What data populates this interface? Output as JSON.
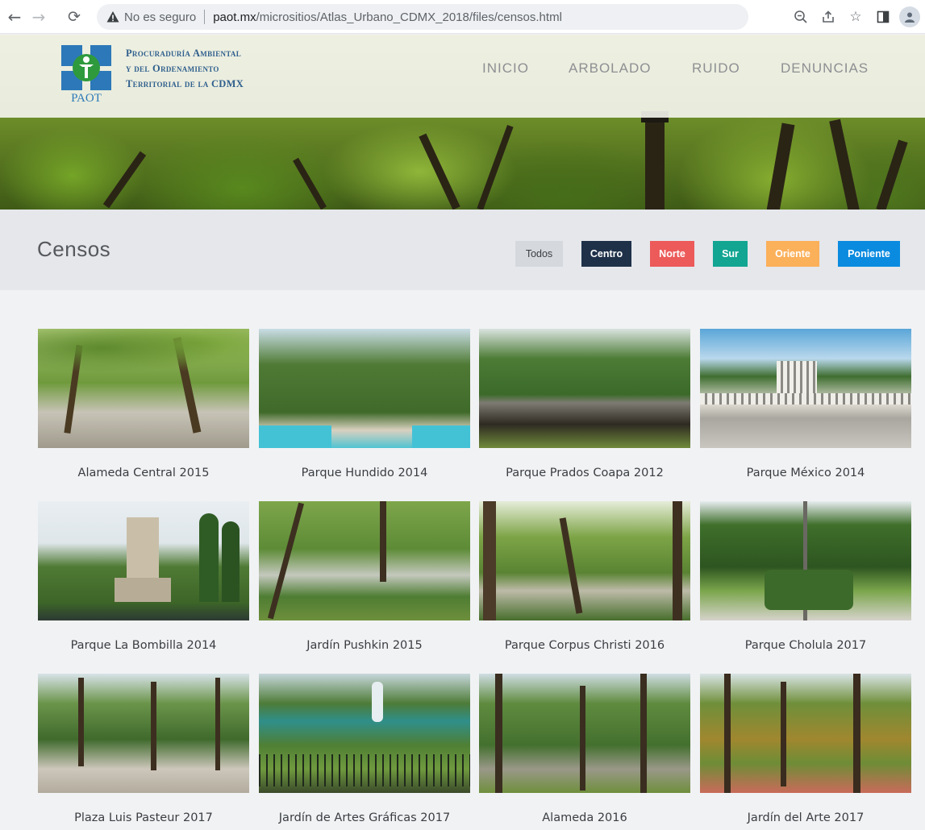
{
  "browser": {
    "insecure_label": "No es seguro",
    "url_host": "paot.mx",
    "url_path": "/micrositios/Atlas_Urbano_CDMX_2018/files/censos.html"
  },
  "site": {
    "logo_text_line1": "Procuraduría Ambiental",
    "logo_text_line2": "y del Ordenamiento",
    "logo_text_line3": "Territorial de la CDMX",
    "logo_abbrev": "PAOT",
    "nav": [
      "INICIO",
      "ARBOLADO",
      "RUIDO",
      "DENUNCIAS"
    ]
  },
  "page": {
    "title": "Censos",
    "filters": [
      {
        "label": "Todos",
        "color": "#d5d8dc",
        "text_color": "#3b3f44"
      },
      {
        "label": "Centro",
        "color": "#1f3149",
        "text_color": "#ffffff"
      },
      {
        "label": "Norte",
        "color": "#ec5a5a",
        "text_color": "#ffffff"
      },
      {
        "label": "Sur",
        "color": "#11a592",
        "text_color": "#ffffff"
      },
      {
        "label": "Oriente",
        "color": "#fbb05a",
        "text_color": "#ffffff"
      },
      {
        "label": "Poniente",
        "color": "#0a8be0",
        "text_color": "#ffffff"
      }
    ]
  },
  "gallery": [
    {
      "title": "Alameda Central 2015"
    },
    {
      "title": "Parque Hundido 2014"
    },
    {
      "title": "Parque Prados Coapa 2012"
    },
    {
      "title": "Parque México 2014"
    },
    {
      "title": "Parque La Bombilla 2014"
    },
    {
      "title": "Jardín Pushkin 2015"
    },
    {
      "title": "Parque Corpus Christi 2016"
    },
    {
      "title": "Parque Cholula 2017"
    },
    {
      "title": "Plaza Luis Pasteur 2017"
    },
    {
      "title": "Jardín de Artes Gráficas 2017"
    },
    {
      "title": "Alameda 2016"
    },
    {
      "title": "Jardín del Arte 2017"
    }
  ]
}
